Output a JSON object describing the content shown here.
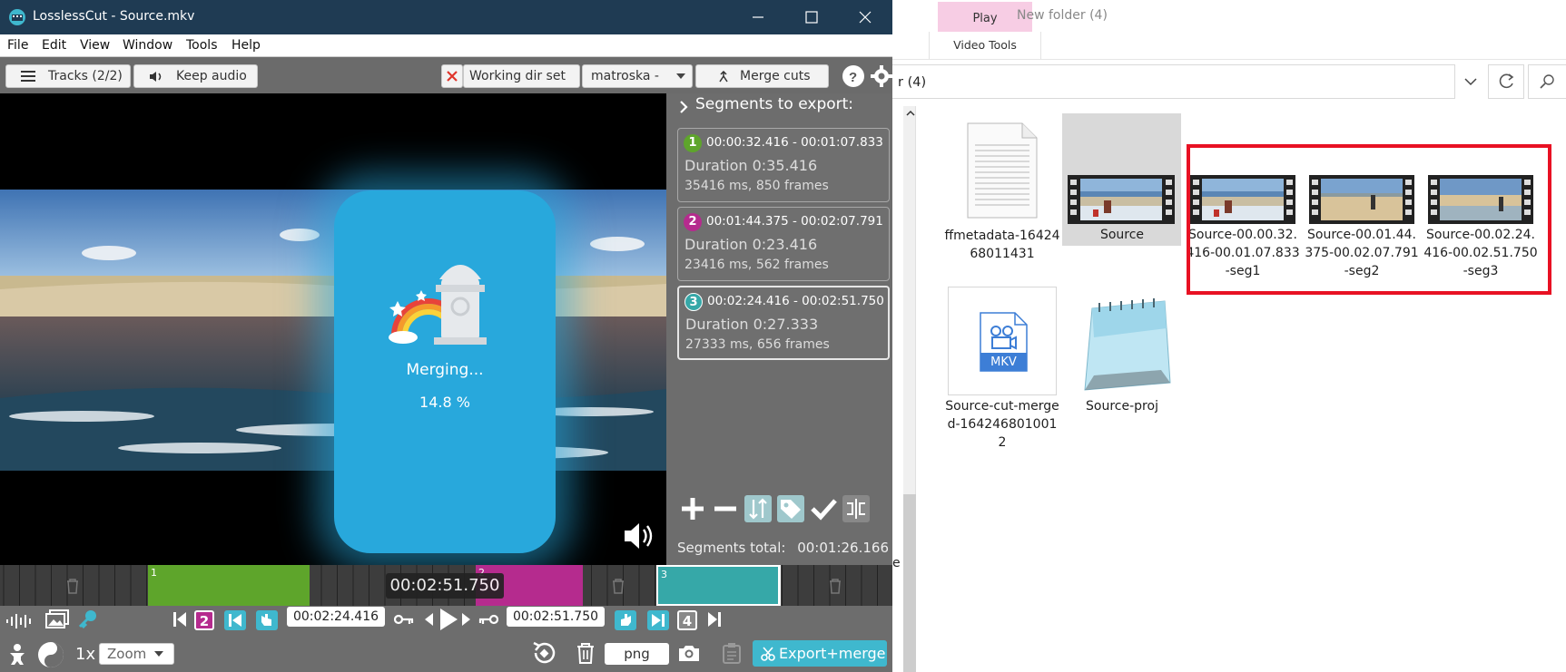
{
  "lc": {
    "title": "LosslessCut - Source.mkv",
    "menu": [
      "File",
      "Edit",
      "View",
      "Window",
      "Tools",
      "Help"
    ],
    "toolbar": {
      "tracks": "Tracks (2/2)",
      "keep_audio": "Keep audio",
      "working_dir": "Working dir set",
      "format": "matroska -",
      "merge_cuts": "Merge cuts"
    },
    "overlay": {
      "status": "Merging...",
      "percent": "14.8 %"
    },
    "segments_header": "Segments to export:",
    "segments": [
      {
        "num": "1",
        "color": "#5ea52b",
        "range": "00:00:32.416 - 00:01:07.833",
        "duration": "Duration 0:35.416",
        "frames": "35416 ms, 850 frames"
      },
      {
        "num": "2",
        "color": "#b52b8e",
        "range": "00:01:44.375 - 00:02:07.791",
        "duration": "Duration 0:23.416",
        "frames": "23416 ms, 562 frames"
      },
      {
        "num": "3",
        "color": "#36a8a8",
        "range": "00:02:24.416 - 00:02:51.750",
        "duration": "Duration 0:27.333",
        "frames": "27333 ms, 656 frames"
      }
    ],
    "segments_total_label": "Segments total:",
    "segments_total_value": "00:01:26.166",
    "timeline": {
      "current_time": "00:02:51.750",
      "segment_labels": [
        "1",
        "2",
        "3"
      ]
    },
    "controls": {
      "seg_start_badge": "2",
      "seg_end_badge": "4",
      "start_time": "00:02:24.416",
      "end_time": "00:02:51.750",
      "speed": "1x",
      "zoom_placeholder": "Zoom",
      "capture_format": "png",
      "export": "Export+merge"
    },
    "colors": {
      "accent": "#3fb8ce",
      "titlebar": "#1f3b53",
      "seg1": "#5ea52b",
      "seg2": "#b52b8e",
      "seg3": "#36a8a8"
    }
  },
  "explorer": {
    "ribbon_play": "Play",
    "ribbon_video_tools": "Video Tools",
    "folder_title": "New folder (4)",
    "address": "r (4)",
    "stray": "e",
    "files": [
      {
        "name": "ffmetadata-1642468011431",
        "icon": "text-file-icon"
      },
      {
        "name": "Source",
        "icon": "video-thumbnail-icon"
      },
      {
        "name": "Source-00.00.32.416-00.01.07.833-seg1",
        "icon": "video-thumbnail-icon"
      },
      {
        "name": "Source-00.01.44.375-00.02.07.791-seg2",
        "icon": "video-thumbnail-icon"
      },
      {
        "name": "Source-00.02.24.416-00.02.51.750-seg3",
        "icon": "video-thumbnail-icon"
      },
      {
        "name": "Source-cut-merged-1642468010012",
        "icon": "mkv-file-icon",
        "badge": "MKV"
      },
      {
        "name": "Source-proj",
        "icon": "notepad-icon"
      }
    ]
  }
}
